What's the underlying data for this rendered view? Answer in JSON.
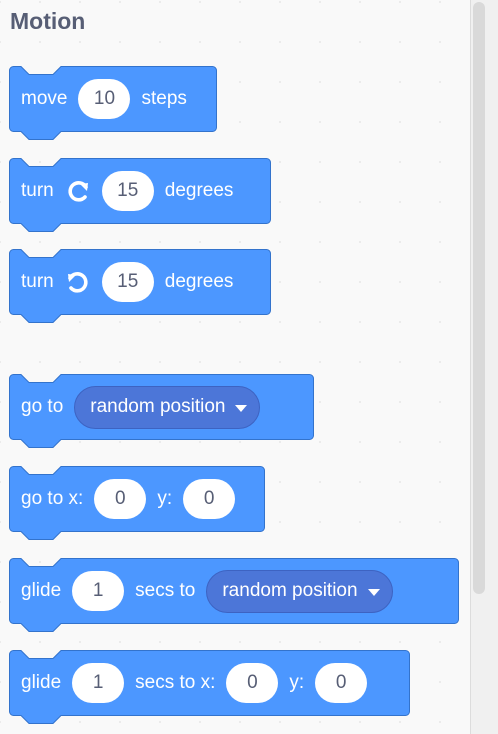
{
  "category": {
    "title": "Motion"
  },
  "colors": {
    "block_fill": "#4c97ff",
    "block_stroke": "#3373cc",
    "dropdown_fill": "#4c76d8",
    "text_dark": "#575e75"
  },
  "blocks": {
    "move": {
      "label": "move",
      "steps": "10",
      "suffix": "steps"
    },
    "turn_right": {
      "label": "turn",
      "icon": "rotate-right-icon",
      "degrees": "15",
      "suffix": "degrees"
    },
    "turn_left": {
      "label": "turn",
      "icon": "rotate-left-icon",
      "degrees": "15",
      "suffix": "degrees"
    },
    "goto": {
      "label": "go to",
      "target": "random position"
    },
    "goto_xy": {
      "label": "go to x:",
      "x": "0",
      "ylabel": "y:",
      "y": "0"
    },
    "glide_to": {
      "label": "glide",
      "secs": "1",
      "mid": "secs to",
      "target": "random position"
    },
    "glide_xy": {
      "label": "glide",
      "secs": "1",
      "mid": "secs to x:",
      "x": "0",
      "ylabel": "y:",
      "y": "0"
    }
  }
}
